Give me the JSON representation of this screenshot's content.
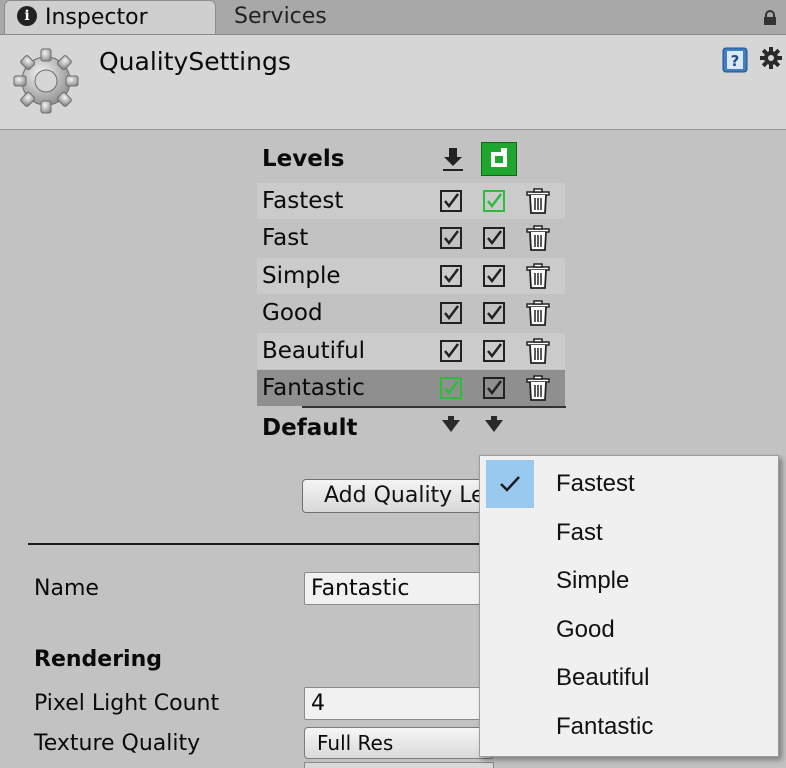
{
  "tabs": {
    "inspector": "Inspector",
    "services": "Services"
  },
  "header": {
    "title": "QualitySettings"
  },
  "levels": {
    "heading": "Levels",
    "rows": [
      {
        "label": "Fastest"
      },
      {
        "label": "Fast"
      },
      {
        "label": "Simple"
      },
      {
        "label": "Good"
      },
      {
        "label": "Beautiful"
      },
      {
        "label": "Fantastic"
      }
    ],
    "default_label": "Default",
    "add_button": "Add Quality Level"
  },
  "fields": {
    "name_label": "Name",
    "name_value": "Fantastic",
    "rendering_heading": "Rendering",
    "pixel_light_label": "Pixel Light Count",
    "pixel_light_value": "4",
    "texture_quality_label": "Texture Quality",
    "texture_quality_value": "Full Res"
  },
  "dropdown": {
    "options": [
      "Fastest",
      "Fast",
      "Simple",
      "Good",
      "Beautiful",
      "Fantastic"
    ],
    "selected": "Fastest"
  },
  "colors": {
    "panel_bg": "#c2c2c2",
    "highlight": "#99c9ef",
    "android_green": "#1ea62e",
    "check_green": "#2dbd3a"
  }
}
